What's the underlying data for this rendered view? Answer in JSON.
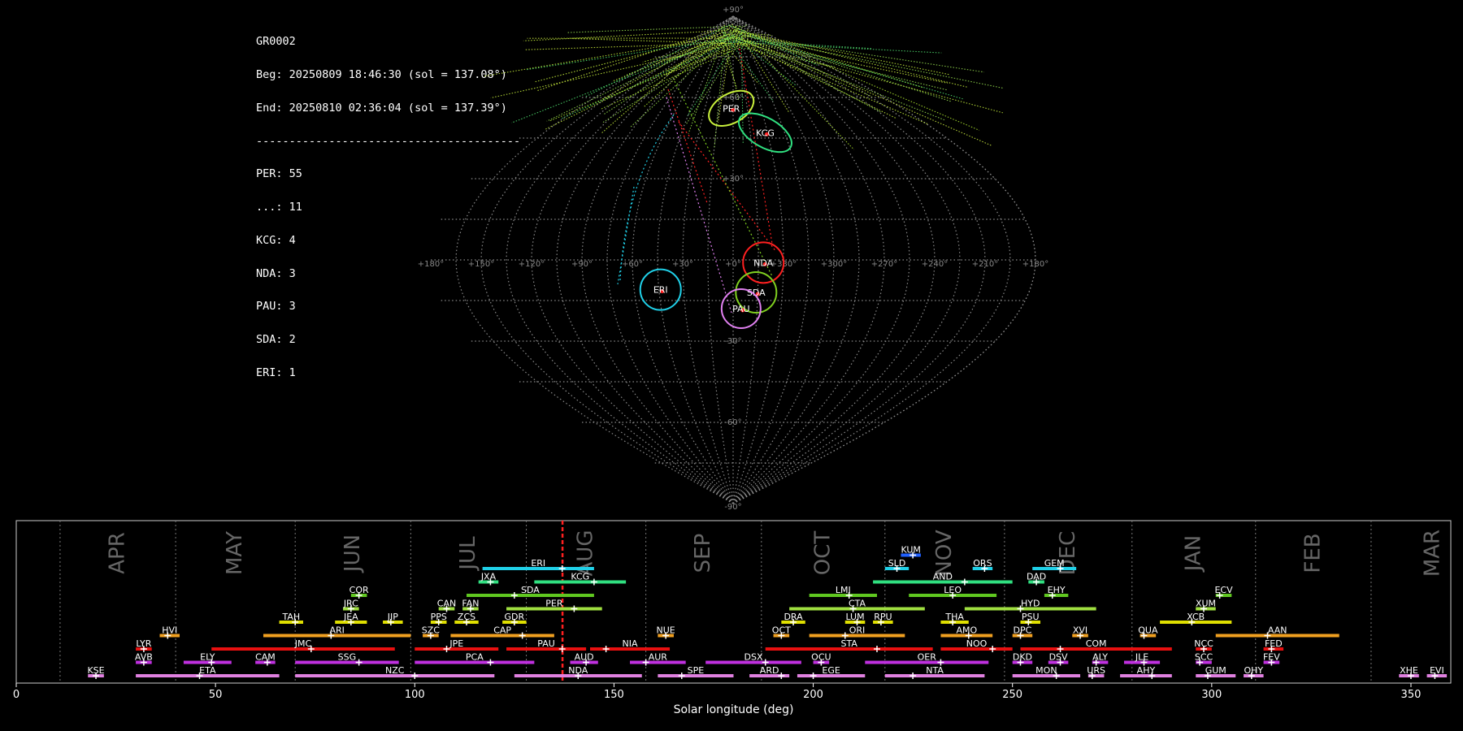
{
  "info": {
    "lines": [
      "GR0002",
      "Beg: 20250809 18:46:30 (sol = 137.08°)",
      "End: 20250810 02:36:04 (sol = 137.39°)",
      "----------------------------------------",
      "PER: 55",
      "...: 11",
      "KCG: 4",
      "NDA: 3",
      "PAU: 3",
      "SDA: 2",
      "ERI: 1"
    ]
  },
  "colors": {
    "background": "#000000",
    "grid": "#8a8a8a",
    "current_sol": "#ff2020",
    "PER": "#c8f03c",
    "KCG": "#30e080",
    "NDA": "#ff2020",
    "PAU": "#e080f0",
    "SDA": "#80d020",
    "ERI": "#20d0e8"
  },
  "chart_data": [
    {
      "type": "scatter",
      "projection": "sinusoidal sky map (radiant positions)",
      "lon_ticks": [
        "+180°",
        "+150°",
        "+120°",
        "+90°",
        "+60°",
        "+30°",
        "+0°",
        "+330°",
        "+300°",
        "+270°",
        "+240°",
        "+210°",
        "+180°"
      ],
      "lat_ticks": [
        "+90°",
        "+60°",
        "+30°",
        "+0°",
        "-30°",
        "-60°",
        "-90°"
      ],
      "radiants": [
        {
          "code": "PER",
          "lon": 2,
          "lat": 56,
          "count": 55,
          "color": "#c8f03c"
        },
        {
          "code": "KCG",
          "lon": 332,
          "lat": 47,
          "count": 4,
          "color": "#30e080"
        },
        {
          "code": "NDA",
          "lon": 342,
          "lat": -1,
          "count": 3,
          "color": "#ff2020"
        },
        {
          "code": "SDA",
          "lon": 346,
          "lat": -12,
          "count": 2,
          "color": "#80d020"
        },
        {
          "code": "PAU",
          "lon": 355,
          "lat": -18,
          "count": 3,
          "color": "#e080f0"
        },
        {
          "code": "ERI",
          "lon": 44,
          "lat": -11,
          "count": 1,
          "color": "#20d0e8"
        }
      ]
    },
    {
      "type": "timeline",
      "xlabel": "Solar longitude (deg)",
      "xlim": [
        0,
        360
      ],
      "x_ticks": [
        0,
        50,
        100,
        150,
        200,
        250,
        300,
        350
      ],
      "current_sol": 137.08,
      "months": [
        {
          "label": "APR",
          "start": 11
        },
        {
          "label": "MAY",
          "start": 40
        },
        {
          "label": "JUN",
          "start": 70
        },
        {
          "label": "JUL",
          "start": 99
        },
        {
          "label": "AUG",
          "start": 128
        },
        {
          "label": "SEP",
          "start": 158
        },
        {
          "label": "OCT",
          "start": 187
        },
        {
          "label": "NOV",
          "start": 218
        },
        {
          "label": "DEC",
          "start": 248
        },
        {
          "label": "JAN",
          "start": 280
        },
        {
          "label": "FEB",
          "start": 311
        },
        {
          "label": "MAR",
          "start": 340
        }
      ],
      "showers": [
        {
          "code": "KUM",
          "start": 222,
          "end": 227,
          "peak": 225,
          "row": 10,
          "color": "#2060ff"
        },
        {
          "code": "ERI",
          "start": 117,
          "end": 145,
          "peak": 137,
          "row": 9,
          "color": "#20d0e8"
        },
        {
          "code": "SLD",
          "start": 218,
          "end": 224,
          "peak": 221,
          "row": 9,
          "color": "#20d0e8"
        },
        {
          "code": "ORS",
          "start": 240,
          "end": 245,
          "peak": 243,
          "row": 9,
          "color": "#20d0e8"
        },
        {
          "code": "GEM",
          "start": 255,
          "end": 266,
          "peak": 262,
          "row": 9,
          "color": "#20d0e8"
        },
        {
          "code": "JXA",
          "start": 116,
          "end": 121,
          "peak": 119,
          "row": 8,
          "color": "#30e080"
        },
        {
          "code": "KCG",
          "start": 130,
          "end": 153,
          "peak": 145,
          "row": 8,
          "color": "#30e080"
        },
        {
          "code": "AND",
          "start": 215,
          "end": 250,
          "peak": 238,
          "row": 8,
          "color": "#30e080"
        },
        {
          "code": "DAD",
          "start": 254,
          "end": 258,
          "peak": 256,
          "row": 8,
          "color": "#30e080"
        },
        {
          "code": "COR",
          "start": 84,
          "end": 88,
          "peak": 86,
          "row": 7,
          "color": "#60c820"
        },
        {
          "code": "SDA",
          "start": 113,
          "end": 145,
          "peak": 125,
          "row": 7,
          "color": "#60c820"
        },
        {
          "code": "LMI",
          "start": 199,
          "end": 216,
          "peak": 209,
          "row": 7,
          "color": "#60c820"
        },
        {
          "code": "LEO",
          "start": 224,
          "end": 246,
          "peak": 235,
          "row": 7,
          "color": "#60c820"
        },
        {
          "code": "EHY",
          "start": 258,
          "end": 264,
          "peak": 260,
          "row": 7,
          "color": "#60c820"
        },
        {
          "code": "ECV",
          "start": 301,
          "end": 305,
          "peak": 302,
          "row": 7,
          "color": "#60c820"
        },
        {
          "code": "JRC",
          "start": 82,
          "end": 86,
          "peak": 84,
          "row": 6,
          "color": "#a0e040"
        },
        {
          "code": "CAN",
          "start": 106,
          "end": 110,
          "peak": 108,
          "row": 6,
          "color": "#a0e040"
        },
        {
          "code": "FAN",
          "start": 112,
          "end": 116,
          "peak": 114,
          "row": 6,
          "color": "#a0e040"
        },
        {
          "code": "PER",
          "start": 123,
          "end": 147,
          "peak": 140,
          "row": 6,
          "color": "#a0e040"
        },
        {
          "code": "CTA",
          "start": 194,
          "end": 228,
          "peak": 210,
          "row": 6,
          "color": "#a0e040"
        },
        {
          "code": "HYD",
          "start": 238,
          "end": 271,
          "peak": 252,
          "row": 6,
          "color": "#a0e040"
        },
        {
          "code": "XUM",
          "start": 296,
          "end": 301,
          "peak": 298,
          "row": 6,
          "color": "#a0e040"
        },
        {
          "code": "TAH",
          "start": 66,
          "end": 72,
          "peak": 70,
          "row": 5,
          "color": "#e0e000"
        },
        {
          "code": "JEA",
          "start": 80,
          "end": 88,
          "peak": 84,
          "row": 5,
          "color": "#e0e000"
        },
        {
          "code": "JIP",
          "start": 92,
          "end": 97,
          "peak": 94,
          "row": 5,
          "color": "#e0e000"
        },
        {
          "code": "PPS",
          "start": 104,
          "end": 108,
          "peak": 106,
          "row": 5,
          "color": "#e0e000"
        },
        {
          "code": "ZCS",
          "start": 110,
          "end": 116,
          "peak": 113,
          "row": 5,
          "color": "#e0e000"
        },
        {
          "code": "GDR",
          "start": 122,
          "end": 128,
          "peak": 125,
          "row": 5,
          "color": "#e0e000"
        },
        {
          "code": "DRA",
          "start": 192,
          "end": 198,
          "peak": 195,
          "row": 5,
          "color": "#e0e000"
        },
        {
          "code": "LUM",
          "start": 208,
          "end": 213,
          "peak": 211,
          "row": 5,
          "color": "#e0e000"
        },
        {
          "code": "RPU",
          "start": 215,
          "end": 220,
          "peak": 217,
          "row": 5,
          "color": "#e0e000"
        },
        {
          "code": "THA",
          "start": 232,
          "end": 239,
          "peak": 235,
          "row": 5,
          "color": "#e0e000"
        },
        {
          "code": "PSU",
          "start": 252,
          "end": 257,
          "peak": 254,
          "row": 5,
          "color": "#e0e000"
        },
        {
          "code": "XCB",
          "start": 287,
          "end": 305,
          "peak": 295,
          "row": 5,
          "color": "#e0e000"
        },
        {
          "code": "HVI",
          "start": 36,
          "end": 41,
          "peak": 38,
          "row": 4,
          "color": "#f0a020"
        },
        {
          "code": "ARI",
          "start": 62,
          "end": 99,
          "peak": 79,
          "row": 4,
          "color": "#f0a020"
        },
        {
          "code": "SZC",
          "start": 102,
          "end": 106,
          "peak": 104,
          "row": 4,
          "color": "#f0a020"
        },
        {
          "code": "CAP",
          "start": 109,
          "end": 135,
          "peak": 127,
          "row": 4,
          "color": "#f0a020"
        },
        {
          "code": "NUE",
          "start": 161,
          "end": 165,
          "peak": 163,
          "row": 4,
          "color": "#f0a020"
        },
        {
          "code": "OCT",
          "start": 190,
          "end": 194,
          "peak": 192,
          "row": 4,
          "color": "#f0a020"
        },
        {
          "code": "ORI",
          "start": 199,
          "end": 223,
          "peak": 208,
          "row": 4,
          "color": "#f0a020"
        },
        {
          "code": "AMO",
          "start": 232,
          "end": 245,
          "peak": 239,
          "row": 4,
          "color": "#f0a020"
        },
        {
          "code": "DPC",
          "start": 250,
          "end": 255,
          "peak": 252,
          "row": 4,
          "color": "#f0a020"
        },
        {
          "code": "XVI",
          "start": 265,
          "end": 269,
          "peak": 267,
          "row": 4,
          "color": "#f0a020"
        },
        {
          "code": "QUA",
          "start": 282,
          "end": 286,
          "peak": 283,
          "row": 4,
          "color": "#f0a020"
        },
        {
          "code": "AAN",
          "start": 301,
          "end": 332,
          "peak": 314,
          "row": 4,
          "color": "#f0a020"
        },
        {
          "code": "LYR",
          "start": 30,
          "end": 34,
          "peak": 32,
          "row": 3,
          "color": "#e81010"
        },
        {
          "code": "JMC",
          "start": 49,
          "end": 95,
          "peak": 74,
          "row": 3,
          "color": "#e81010"
        },
        {
          "code": "JPE",
          "start": 100,
          "end": 121,
          "peak": 108,
          "row": 3,
          "color": "#e81010"
        },
        {
          "code": "PAU",
          "start": 123,
          "end": 143,
          "peak": 137,
          "row": 3,
          "color": "#e81010"
        },
        {
          "code": "NIA",
          "start": 144,
          "end": 164,
          "peak": 148,
          "row": 3,
          "color": "#e81010"
        },
        {
          "code": "STA",
          "start": 188,
          "end": 230,
          "peak": 216,
          "row": 3,
          "color": "#e81010"
        },
        {
          "code": "NOO",
          "start": 232,
          "end": 250,
          "peak": 245,
          "row": 3,
          "color": "#e81010"
        },
        {
          "code": "COM",
          "start": 252,
          "end": 290,
          "peak": 262,
          "row": 3,
          "color": "#e81010"
        },
        {
          "code": "NCC",
          "start": 296,
          "end": 300,
          "peak": 298,
          "row": 3,
          "color": "#e81010"
        },
        {
          "code": "FED",
          "start": 313,
          "end": 318,
          "peak": 315,
          "row": 3,
          "color": "#e81010"
        },
        {
          "code": "AVB",
          "start": 30,
          "end": 34,
          "peak": 32,
          "row": 2,
          "color": "#c030e0"
        },
        {
          "code": "ELY",
          "start": 42,
          "end": 54,
          "peak": 49,
          "row": 2,
          "color": "#c030e0"
        },
        {
          "code": "CAM",
          "start": 60,
          "end": 65,
          "peak": 63,
          "row": 2,
          "color": "#c030e0"
        },
        {
          "code": "SSG",
          "start": 70,
          "end": 96,
          "peak": 86,
          "row": 2,
          "color": "#c030e0"
        },
        {
          "code": "PCA",
          "start": 100,
          "end": 130,
          "peak": 119,
          "row": 2,
          "color": "#c030e0"
        },
        {
          "code": "AUD",
          "start": 139,
          "end": 146,
          "peak": 143,
          "row": 2,
          "color": "#c030e0"
        },
        {
          "code": "AUR",
          "start": 154,
          "end": 168,
          "peak": 158,
          "row": 2,
          "color": "#c030e0"
        },
        {
          "code": "DSX",
          "start": 173,
          "end": 197,
          "peak": 188,
          "row": 2,
          "color": "#c030e0"
        },
        {
          "code": "OCU",
          "start": 200,
          "end": 204,
          "peak": 202,
          "row": 2,
          "color": "#c030e0"
        },
        {
          "code": "OER",
          "start": 213,
          "end": 244,
          "peak": 232,
          "row": 2,
          "color": "#c030e0"
        },
        {
          "code": "DKD",
          "start": 250,
          "end": 255,
          "peak": 252,
          "row": 2,
          "color": "#c030e0"
        },
        {
          "code": "DSV",
          "start": 259,
          "end": 264,
          "peak": 262,
          "row": 2,
          "color": "#c030e0"
        },
        {
          "code": "ALY",
          "start": 270,
          "end": 274,
          "peak": 271,
          "row": 2,
          "color": "#c030e0"
        },
        {
          "code": "JLE",
          "start": 278,
          "end": 287,
          "peak": 283,
          "row": 2,
          "color": "#c030e0"
        },
        {
          "code": "SCC",
          "start": 296,
          "end": 300,
          "peak": 297,
          "row": 2,
          "color": "#c030e0"
        },
        {
          "code": "FEV",
          "start": 313,
          "end": 317,
          "peak": 315,
          "row": 2,
          "color": "#c030e0"
        },
        {
          "code": "KSE",
          "start": 18,
          "end": 22,
          "peak": 20,
          "row": 1,
          "color": "#e080e0"
        },
        {
          "code": "ETA",
          "start": 30,
          "end": 66,
          "peak": 46,
          "row": 1,
          "color": "#e080e0"
        },
        {
          "code": "NZC",
          "start": 70,
          "end": 120,
          "peak": 100,
          "row": 1,
          "color": "#e080e0"
        },
        {
          "code": "NDA",
          "start": 125,
          "end": 157,
          "peak": 141,
          "row": 1,
          "color": "#e080e0"
        },
        {
          "code": "SPE",
          "start": 161,
          "end": 180,
          "peak": 167,
          "row": 1,
          "color": "#e080e0"
        },
        {
          "code": "ARD",
          "start": 184,
          "end": 194,
          "peak": 192,
          "row": 1,
          "color": "#e080e0"
        },
        {
          "code": "EGE",
          "start": 196,
          "end": 213,
          "peak": 200,
          "row": 1,
          "color": "#e080e0"
        },
        {
          "code": "NTA",
          "start": 218,
          "end": 243,
          "peak": 225,
          "row": 1,
          "color": "#e080e0"
        },
        {
          "code": "MON",
          "start": 250,
          "end": 267,
          "peak": 261,
          "row": 1,
          "color": "#e080e0"
        },
        {
          "code": "URS",
          "start": 269,
          "end": 273,
          "peak": 270,
          "row": 1,
          "color": "#e080e0"
        },
        {
          "code": "AHY",
          "start": 277,
          "end": 290,
          "peak": 285,
          "row": 1,
          "color": "#e080e0"
        },
        {
          "code": "GUM",
          "start": 296,
          "end": 306,
          "peak": 299,
          "row": 1,
          "color": "#e080e0"
        },
        {
          "code": "OHY",
          "start": 308,
          "end": 313,
          "peak": 310,
          "row": 1,
          "color": "#e080e0"
        },
        {
          "code": "XHE",
          "start": 347,
          "end": 352,
          "peak": 350,
          "row": 1,
          "color": "#e080e0"
        },
        {
          "code": "EVI",
          "start": 354,
          "end": 359,
          "peak": 356,
          "row": 1,
          "color": "#e080e0"
        }
      ]
    }
  ]
}
